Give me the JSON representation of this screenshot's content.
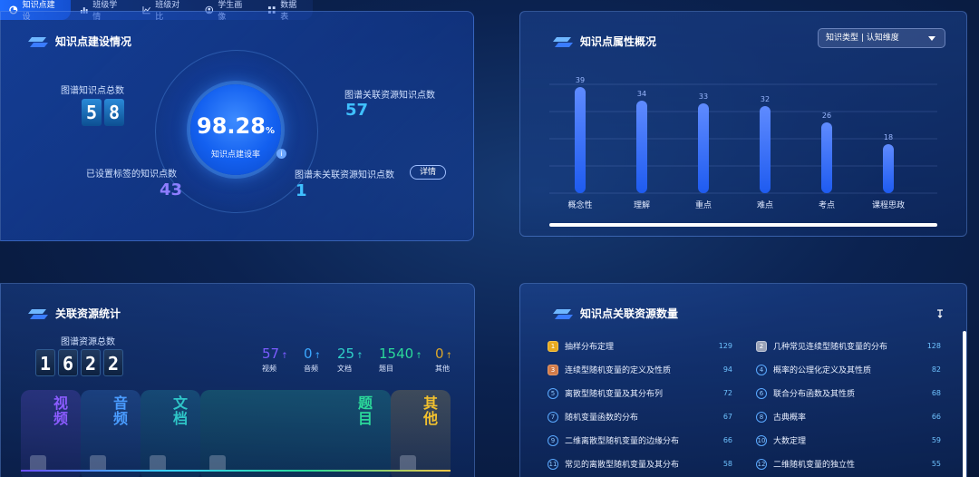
{
  "nav": {
    "items": [
      {
        "label": "知识点建设",
        "icon": "pie-chart-icon",
        "active": true
      },
      {
        "label": "班级学情",
        "icon": "bar-chart-icon",
        "active": false
      },
      {
        "label": "班级对比",
        "icon": "line-chart-icon",
        "active": false
      },
      {
        "label": "学生画像",
        "icon": "user-circle-icon",
        "active": false
      },
      {
        "label": "数据表",
        "icon": "grid-icon",
        "active": false
      }
    ]
  },
  "build": {
    "title": "知识点建设情况",
    "total_label": "图谱知识点总数",
    "total_digits": [
      "5",
      "8"
    ],
    "tagged_label": "已设置标签的知识点数",
    "tagged_value": "43",
    "rate_value": "98.28",
    "rate_unit": "%",
    "rate_label": "知识点建设率",
    "linked_label": "图谱关联资源知识点数",
    "linked_value": "57",
    "unlinked_label": "图谱未关联资源知识点数",
    "unlinked_value": "1",
    "detail_label": "详情"
  },
  "attr": {
    "title": "知识点属性概况",
    "select_value": "知识类型 | 认知维度"
  },
  "chart_data": {
    "type": "bar",
    "categories": [
      "概念性",
      "理解",
      "重点",
      "难点",
      "考点",
      "课程思政"
    ],
    "values": [
      39,
      34,
      33,
      32,
      26,
      18
    ],
    "ylim": [
      0,
      40
    ],
    "grid": true,
    "colors": {
      "bar_top": "#5f8bff",
      "bar_bottom": "#1e5bf0"
    }
  },
  "resource": {
    "title": "关联资源统计",
    "total_label": "图谱资源总数",
    "total_digits": [
      "1",
      "6",
      "2",
      "2"
    ],
    "stats": [
      {
        "value": "57",
        "label": "视频",
        "color": "#7b5cff"
      },
      {
        "value": "0",
        "label": "音频",
        "color": "#3ba7ff"
      },
      {
        "value": "25",
        "label": "文档",
        "color": "#2fd0c8"
      },
      {
        "value": "1540",
        "label": "题目",
        "color": "#2bd99a"
      },
      {
        "value": "0",
        "label": "其他",
        "color": "#d9a62c"
      }
    ],
    "arrow": "↑",
    "cards": [
      {
        "label": "视频",
        "color": "#8b5cff"
      },
      {
        "label": "音频",
        "color": "#4a9cff"
      },
      {
        "label": "文档",
        "color": "#2fc6c8"
      },
      {
        "label": "题目",
        "color": "#2bd99a"
      },
      {
        "label": "其他",
        "color": "#f2c12e"
      }
    ]
  },
  "relate": {
    "title": "知识点关联资源数量",
    "sort_icon": "sort-icon",
    "left": [
      {
        "rank": "1",
        "name": "抽样分布定理",
        "count": "129",
        "badge": "gold"
      },
      {
        "rank": "3",
        "name": "连续型随机变量的定义及性质",
        "count": "94",
        "badge": "bronze"
      },
      {
        "rank": "5",
        "name": "离散型随机变量及其分布列",
        "count": "72",
        "badge": ""
      },
      {
        "rank": "7",
        "name": "随机变量函数的分布",
        "count": "67",
        "badge": ""
      },
      {
        "rank": "9",
        "name": "二维离散型随机变量的边缘分布",
        "count": "66",
        "badge": ""
      },
      {
        "rank": "11",
        "name": "常见的离散型随机变量及其分布",
        "count": "58",
        "badge": ""
      }
    ],
    "right": [
      {
        "rank": "2",
        "name": "几种常见连续型随机变量的分布",
        "count": "128",
        "badge": "silver"
      },
      {
        "rank": "4",
        "name": "概率的公理化定义及其性质",
        "count": "82",
        "badge": ""
      },
      {
        "rank": "6",
        "name": "联合分布函数及其性质",
        "count": "68",
        "badge": ""
      },
      {
        "rank": "8",
        "name": "古典概率",
        "count": "66",
        "badge": ""
      },
      {
        "rank": "10",
        "name": "大数定理",
        "count": "59",
        "badge": ""
      },
      {
        "rank": "12",
        "name": "二维随机变量的独立性",
        "count": "55",
        "badge": ""
      }
    ]
  }
}
